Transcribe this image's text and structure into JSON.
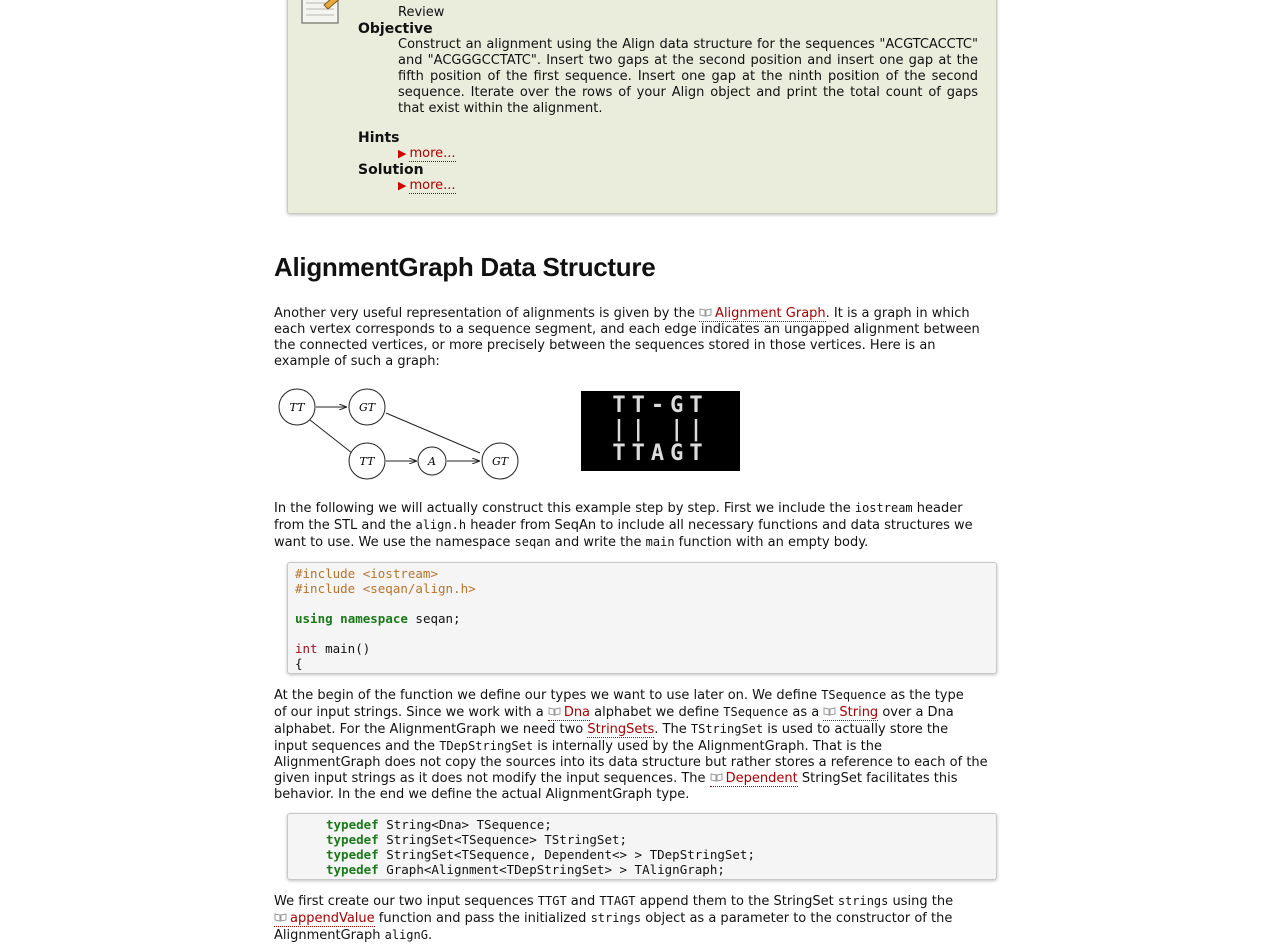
{
  "exercise": {
    "type_value": "Review",
    "objective_heading": "Objective",
    "objective_lines": [
      "Construct an alignment using the Align data structure for the sequences \"ACGTCACCTC\"",
      "and \"ACGGGCCTATC\". Insert two gaps at the second position and insert one gap at the",
      "fifth position of the first sequence. Insert one gap at the ninth position of the second",
      "sequence. Iterate over the rows of your Align object and print the total count of gaps",
      "that exist within the alignment."
    ],
    "hints_heading": "Hints",
    "solution_heading": "Solution",
    "more_label": "more..."
  },
  "section": {
    "title": "AlignmentGraph Data Structure"
  },
  "para1": {
    "line1_a": "Another very useful representation of alignments is given by the ",
    "link_alignment_graph": "Alignment Graph",
    "line1_b": ". It is a graph in which",
    "line2": "each vertex corresponds to a sequence segment, and each edge indicates an ungapped alignment between",
    "line3": "the connected vertices, or more precisely between the sequences stored in those vertices. Here is an",
    "line4": "example of such a graph:"
  },
  "graph": {
    "nodes": {
      "n1": "TT",
      "n2": "GT",
      "n3": "TT",
      "n4": "A",
      "n5": "GT"
    }
  },
  "banner": {
    "row1": "TT-GT",
    "row2": "|| ||",
    "row3": "TTAGT"
  },
  "para2": {
    "l1a": "In the following we will actually construct this example step by step. First we include the ",
    "l1code": "iostream",
    "l1b": " header",
    "l2a": "from the STL and the ",
    "l2code": "align.h",
    "l2b": " header from SeqAn to include all necessary functions and data structures we",
    "l3a": "want to use. We use the namespace ",
    "l3code1": "seqan",
    "l3b": " and write the ",
    "l3code2": "main",
    "l3c": " function with an empty body."
  },
  "code1": {
    "inc1": "#include <iostream>",
    "inc2": "#include <seqan/align.h>",
    "using_kw": "using",
    "namespace_kw": "namespace",
    "using_rest": " seqan;",
    "int_kw": "int",
    "main_rest": " main()",
    "brace": "{"
  },
  "para3": {
    "l1a": "At the begin of the function we define our types we want to use later on. We define ",
    "l1code": "TSequence",
    "l1b": " as the type",
    "l2a": "of our input strings. Since we work with a ",
    "l2link1": "Dna",
    "l2b": " alphabet we define ",
    "l2code": "TSequence",
    "l2c": " as a ",
    "l2link2": "String",
    "l2d": " over a Dna",
    "l3a": "alphabet. For the AlignmentGraph we need two ",
    "l3link": "StringSets",
    "l3b": ". The ",
    "l3code": "TStringSet",
    "l3c": " is used to actually store the",
    "l4a": "input sequences and the ",
    "l4code": "TDepStringSet",
    "l4b": " is internally used by the AlignmentGraph. That is the",
    "l5": "AlignmentGraph does not copy the sources into its data structure but rather stores a reference to each of the",
    "l6a": "given input strings as it does not modify the input sequences. The ",
    "l6link": "Dependent",
    "l6b": " StringSet facilitates this",
    "l7": "behavior. In the end we define the actual AlignmentGraph type."
  },
  "code2": {
    "kw": "typedef",
    "line1": " String<Dna> TSequence;",
    "line2": " StringSet<TSequence> TStringSet;",
    "line3": " StringSet<TSequence, Dependent<> > TDepStringSet;",
    "line4": " Graph<Alignment<TDepStringSet> > TAlignGraph;"
  },
  "para4": {
    "l1a": "We first create our two input sequences ",
    "l1code1": "TTGT",
    "l1b": " and ",
    "l1code2": "TTAGT",
    "l1c": " append them to the StringSet ",
    "l1code3": "strings",
    "l1d": " using the",
    "l2link": "appendValue",
    "l2a": " function and pass the initialized ",
    "l2code": "strings",
    "l2b": " object as a parameter to the constructor of the",
    "l3a": "AlignmentGraph ",
    "l3code": "alignG",
    "l3b": "."
  },
  "colors": {
    "link": "#aa0000",
    "keyword": "#1a7a1a",
    "preprocessor": "#b8732a",
    "box_bg": "#eaecdc"
  }
}
